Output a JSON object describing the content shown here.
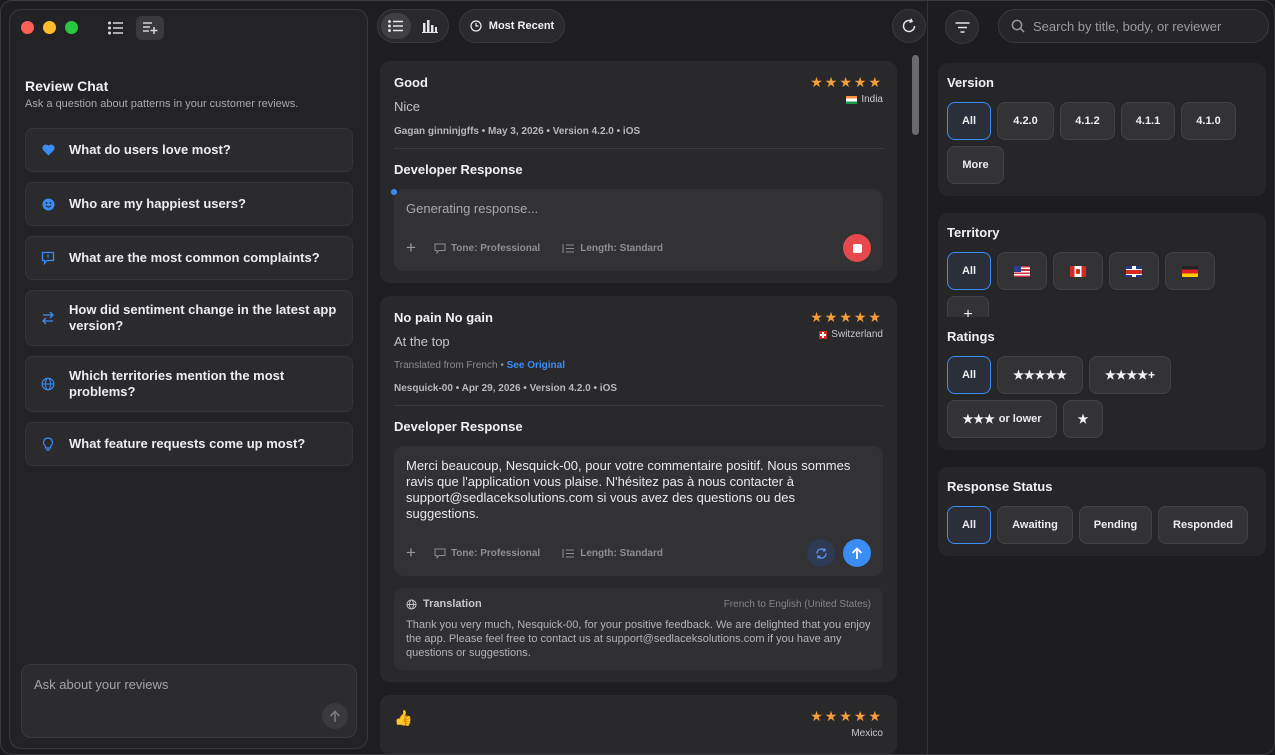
{
  "sidebar": {
    "chat_title": "Review Chat",
    "chat_subtitle": "Ask a question about patterns in your customer reviews.",
    "suggestions": [
      {
        "label": "What do users love most?",
        "icon": "heart-icon"
      },
      {
        "label": "Who are my happiest users?",
        "icon": "smiley-icon"
      },
      {
        "label": "What are the most common complaints?",
        "icon": "speech-bubble-icon"
      },
      {
        "label": "How did sentiment change in the latest app version?",
        "icon": "swap-arrows-icon"
      },
      {
        "label": "Which territories mention the most problems?",
        "icon": "globe-icon"
      },
      {
        "label": "What feature requests come up most?",
        "icon": "lightbulb-icon"
      }
    ],
    "input_placeholder": "Ask about your reviews"
  },
  "toolbar": {
    "sort_label": "Most Recent"
  },
  "reviews": [
    {
      "title": "Good",
      "body": "Nice",
      "stars": "★★★★★",
      "country": "India",
      "meta": "Gagan ginninjgffs  •  May 3, 2026 • Version 4.2.0 • iOS",
      "developer_response_title": "Developer Response",
      "response_text": "Generating response...",
      "tone": "Tone: Professional",
      "length": "Length: Standard"
    },
    {
      "title": "No pain No gain",
      "body": "At the top",
      "stars": "★★★★★",
      "country": "Switzerland",
      "translated_from": "Translated from French",
      "see_original": "See Original",
      "meta": "Nesquick-00  •  Apr 29, 2026 • Version 4.2.0 • iOS",
      "developer_response_title": "Developer Response",
      "response_text": "Merci beaucoup, Nesquick-00, pour votre commentaire positif. Nous sommes ravis que l'application vous plaise. N'hésitez pas à nous contacter à support@sedlaceksolutions.com si vous avez des questions ou des suggestions.",
      "tone": "Tone: Professional",
      "length": "Length: Standard",
      "translation_label": "Translation",
      "translation_lang": "French to English (United States)",
      "translation_text": "Thank you very much, Nesquick-00, for your positive feedback. We are delighted that you enjoy the app. Please feel free to contact us at support@sedlaceksolutions.com if you have any questions or suggestions."
    },
    {
      "title": "👍",
      "stars": "★★★★★",
      "country": "Mexico"
    }
  ],
  "filters": {
    "search_placeholder": "Search by title, body, or reviewer",
    "version": {
      "title": "Version",
      "options": [
        "All",
        "4.2.0",
        "4.1.2",
        "4.1.1",
        "4.1.0",
        "More"
      ]
    },
    "territory": {
      "title": "Territory",
      "all": "All",
      "flags": [
        "us-flag-icon",
        "canada-flag-icon",
        "uk-flag-icon",
        "germany-flag-icon"
      ],
      "more": "+"
    },
    "ratings": {
      "title": "Ratings",
      "all": "All",
      "five": "★★★★★",
      "four_plus": "★★★★+",
      "three_lower_stars": "★★★",
      "three_lower_text": "or lower",
      "one": "★"
    },
    "response_status": {
      "title": "Response Status",
      "options": [
        "All",
        "Awaiting",
        "Pending",
        "Responded"
      ]
    }
  },
  "colors": {
    "accent": "#3a8df5",
    "stars": "#f59e3b",
    "stop": "#e5484d"
  }
}
